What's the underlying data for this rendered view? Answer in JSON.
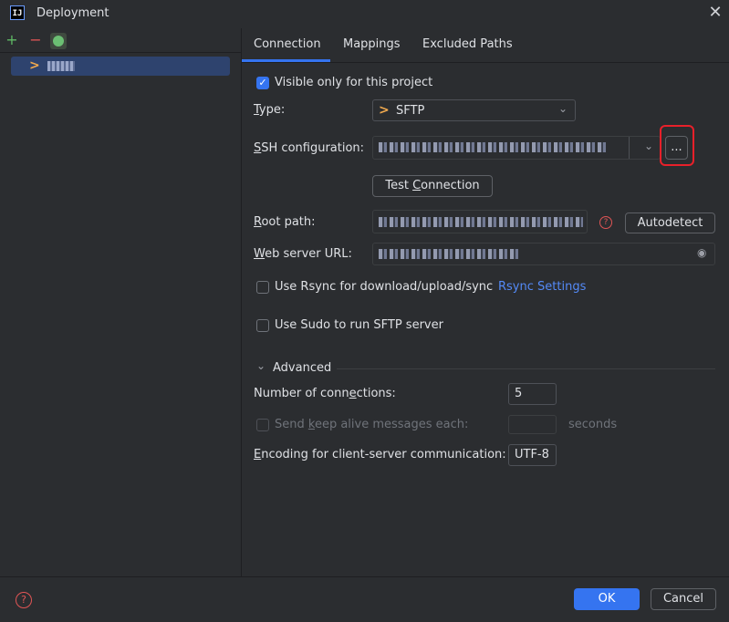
{
  "window": {
    "title": "Deployment",
    "app_icon_text": "IJ",
    "close_icon": "close-icon"
  },
  "toolbar": {
    "add_symbol": "+",
    "remove_symbol": "−",
    "default_icon": "check-badge-icon"
  },
  "server_list": {
    "selected_icon": "sftp-icon"
  },
  "tabs": [
    {
      "label": "Connection",
      "active": true
    },
    {
      "label": "Mappings",
      "active": false
    },
    {
      "label": "Excluded Paths",
      "active": false
    }
  ],
  "connection": {
    "visible_only_label": "Visible only for this project",
    "visible_only_checked": true,
    "type_label": "Type:",
    "type_value": "SFTP",
    "ssh_config_label": "SSH configuration:",
    "ssh_browse_label": "...",
    "test_connection_label": "Test Connection",
    "root_path_label": "Root path:",
    "autodetect_label": "Autodetect",
    "web_url_label": "Web server URL:",
    "rsync_label": "Use Rsync for download/upload/sync",
    "rsync_checked": false,
    "rsync_settings_link": "Rsync Settings",
    "sudo_label": "Use Sudo to run SFTP server",
    "sudo_checked": false
  },
  "advanced": {
    "section_label": "Advanced",
    "connections_label": "Number of connections:",
    "connections_value": "5",
    "keepalive_label": "Send keep alive messages each:",
    "keepalive_value": "",
    "keepalive_unit": "seconds",
    "encoding_label": "Encoding for client-server communication:",
    "encoding_value": "UTF-8"
  },
  "footer": {
    "help_symbol": "?",
    "ok_label": "OK",
    "cancel_label": "Cancel"
  },
  "colors": {
    "accent": "#3574f0",
    "highlight_box": "#e8202a",
    "sftp_icon": "#f0a94e"
  }
}
